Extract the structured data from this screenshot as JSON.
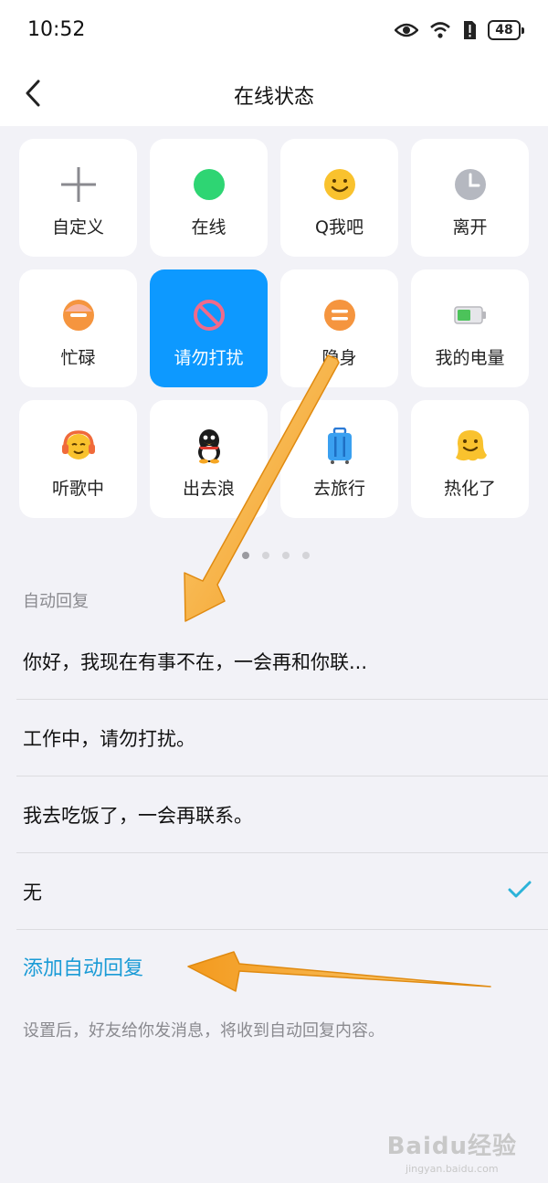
{
  "status_bar": {
    "time": "10:52",
    "battery": "48"
  },
  "header": {
    "title": "在线状态"
  },
  "status_grid": {
    "items": [
      {
        "label": "自定义",
        "icon": "plus-icon"
      },
      {
        "label": "在线",
        "icon": "online-dot-icon"
      },
      {
        "label": "Q我吧",
        "icon": "smile-icon"
      },
      {
        "label": "离开",
        "icon": "clock-icon"
      },
      {
        "label": "忙碌",
        "icon": "busy-icon"
      },
      {
        "label": "请勿打扰",
        "icon": "do-not-disturb-icon",
        "selected": true
      },
      {
        "label": "隐身",
        "icon": "invisible-icon"
      },
      {
        "label": "我的电量",
        "icon": "battery-icon"
      },
      {
        "label": "听歌中",
        "icon": "headphones-icon"
      },
      {
        "label": "出去浪",
        "icon": "penguin-icon"
      },
      {
        "label": "去旅行",
        "icon": "suitcase-icon"
      },
      {
        "label": "热化了",
        "icon": "melting-face-icon"
      }
    ],
    "page_count": 4,
    "active_page": 1
  },
  "auto_reply": {
    "section_label": "自动回复",
    "options": [
      {
        "text": "你好，我现在有事不在，一会再和你联..."
      },
      {
        "text": "工作中，请勿打扰。"
      },
      {
        "text": "我去吃饭了，一会再联系。"
      },
      {
        "text": "无",
        "checked": true
      }
    ],
    "add_label": "添加自动回复",
    "hint": "设置后，好友给你发消息，将收到自动回复内容。"
  },
  "watermark": {
    "main": "Baidu经验",
    "sub": "jingyan.baidu.com"
  },
  "colors": {
    "accent": "#0d99ff",
    "link": "#1a9bd6",
    "arrow": "#f5a623"
  }
}
